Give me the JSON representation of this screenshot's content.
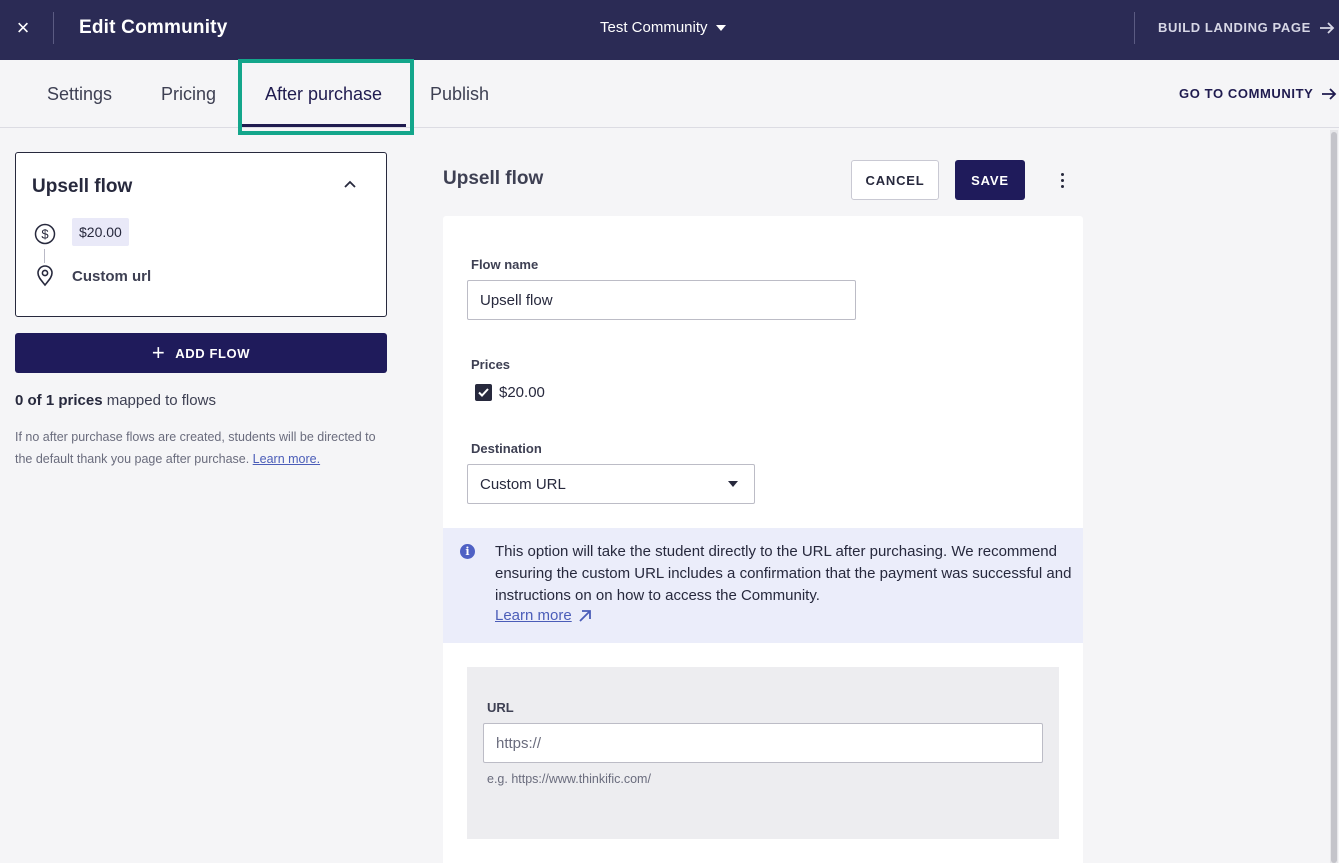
{
  "header": {
    "close_icon": "close-icon",
    "title": "Edit Community",
    "community_name": "Test Community",
    "build_landing_page": "BUILD LANDING PAGE"
  },
  "tabs": [
    {
      "label": "Settings"
    },
    {
      "label": "Pricing"
    },
    {
      "label": "After purchase",
      "active": true
    },
    {
      "label": "Publish"
    }
  ],
  "go_to_community": "GO TO COMMUNITY",
  "sidebar": {
    "flow_card": {
      "title": "Upsell flow",
      "price": "$20.00",
      "destination": "Custom url"
    },
    "add_flow": "ADD FLOW",
    "mapped_bold": "0 of 1 prices",
    "mapped_rest": " mapped to flows",
    "help_text": "If no after purchase flows are created, students will be directed to the default thank you page after purchase. ",
    "help_link": "Learn more."
  },
  "editor": {
    "title": "Upsell flow",
    "cancel": "CANCEL",
    "save": "SAVE",
    "flow_name_label": "Flow name",
    "flow_name_value": "Upsell flow",
    "prices_label": "Prices",
    "price_option": "$20.00",
    "price_checked": true,
    "destination_label": "Destination",
    "destination_value": "Custom URL",
    "info_text": "This option will take the student directly to the URL after purchasing. We recommend ensuring the custom URL includes a confirmation that the payment was successful and instructions on on how to access the Community.",
    "learn_more": "Learn more ",
    "url_label": "URL",
    "url_placeholder": "https://",
    "url_hint": "e.g. https://www.thinkific.com/"
  },
  "colors": {
    "topbar": "#2b2b55",
    "primary": "#1f1b5b",
    "highlight": "#13a68b",
    "info_bg": "#ebedfa",
    "link": "#4b5db8"
  }
}
